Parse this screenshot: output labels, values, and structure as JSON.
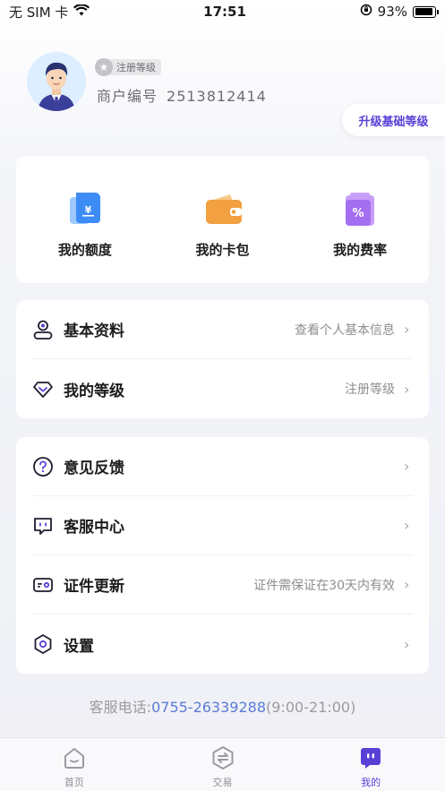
{
  "status_bar": {
    "carrier": "无 SIM 卡",
    "time": "17:51",
    "battery": "93%",
    "battery_level": 0.93
  },
  "profile": {
    "level_badge": "注册等级",
    "merchant_label": "商户编号",
    "merchant_id": "2513812414",
    "upgrade_button": "升级基础等级"
  },
  "quick_actions": [
    {
      "label": "我的额度",
      "icon": "quota-icon"
    },
    {
      "label": "我的卡包",
      "icon": "wallet-icon"
    },
    {
      "label": "我的费率",
      "icon": "rate-icon"
    }
  ],
  "menu_group1": [
    {
      "label": "基本资料",
      "sub": "查看个人基本信息",
      "icon": "user-icon"
    },
    {
      "label": "我的等级",
      "sub": "注册等级",
      "icon": "diamond-icon"
    }
  ],
  "menu_group2": [
    {
      "label": "意见反馈",
      "sub": "",
      "icon": "question-icon"
    },
    {
      "label": "客服中心",
      "sub": "",
      "icon": "chat-icon"
    },
    {
      "label": "证件更新",
      "sub": "证件需保证在30天内有效",
      "icon": "id-card-icon"
    },
    {
      "label": "设置",
      "sub": "",
      "icon": "settings-icon"
    }
  ],
  "hotline": {
    "label": "客服电话:",
    "phone": "0755-26339288",
    "hours": "(9:00-21:00)"
  },
  "tab_bar": [
    {
      "label": "首页",
      "icon": "home-icon",
      "active": false
    },
    {
      "label": "交易",
      "icon": "transaction-icon",
      "active": false
    },
    {
      "label": "我的",
      "icon": "mine-icon",
      "active": true
    }
  ],
  "colors": {
    "accent": "#5a3fd6",
    "phone_link": "#5b7bd5",
    "quota_blue": "#3d8cf5",
    "wallet_orange": "#f2a040",
    "rate_purple": "#a46ef0"
  }
}
